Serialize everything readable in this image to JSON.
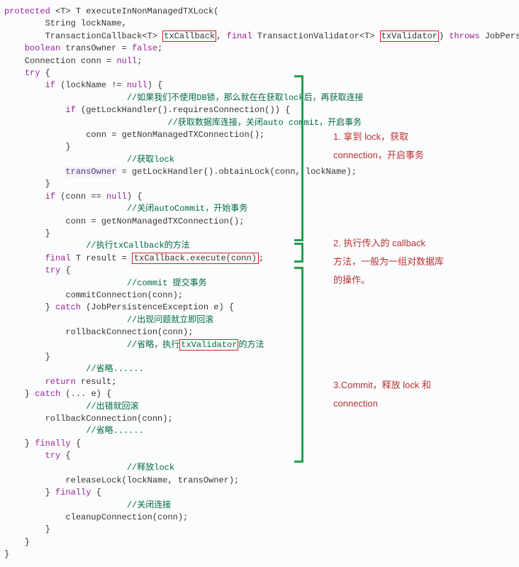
{
  "code": {
    "l1": "protected <T> T executeInNonManagedTXLock(",
    "l2": "        String lockName,",
    "l3a": "        TransactionCallback<T> ",
    "l3b": "txCallback",
    "l3c": ", final TransactionValidator<T> ",
    "l3d": "txValidator",
    "l3e": ") throws JobPersistenceException {",
    "l4": "    boolean transOwner = false;",
    "l5": "    Connection conn = null;",
    "l6": "    try {",
    "l7": "        if (lockName != null) {",
    "l8": "            //如果我们不使用DB锁，那么就在在获取lock后，再获取连接",
    "l9": "            if (getLockHandler().requiresConnection()) {",
    "l10": "                //获取数据库连接，关闭auto commit，开启事务",
    "l11": "                conn = getNonManagedTXConnection();",
    "l12": "            }",
    "l13": "            //获取lock",
    "l14a": "            ",
    "l14b": "transOwner",
    "l14c": " = getLockHandler().obtainLock(conn, lockName);",
    "l15": "        }",
    "l16": "        if (conn == null) {",
    "l17": "            //关闭autoCommit，开始事务",
    "l18": "            conn = getNonManagedTXConnection();",
    "l19": "        }",
    "l20": "        //执行txCallback的方法",
    "l21a": "        final T result = ",
    "l21b": "txCallback.execute(conn)",
    "l21c": ";",
    "l22": "        try {",
    "l23": "            //commit 提交事务",
    "l24": "            commitConnection(conn);",
    "l25": "        } catch (JobPersistenceException e) {",
    "l26": "            //出现问题就立即回滚",
    "l27": "            rollbackConnection(conn);",
    "l28a": "            //省略，执行",
    "l28b": "txValidator",
    "l28c": "的方法",
    "l29": "        }",
    "l30": "        //省略......",
    "l31": "        return result;",
    "l32": "    } catch (... e) {",
    "l33": "        //出错就回滚",
    "l34": "        rollbackConnection(conn);",
    "l35": "        //省略......",
    "l36": "    } finally {",
    "l37": "        try {",
    "l38": "            //释放lock",
    "l39": "            releaseLock(lockName, transOwner);",
    "l40": "        } finally {",
    "l41": "            //关闭连接",
    "l42": "            cleanupConnection(conn);",
    "l43": "        }",
    "l44": "    }",
    "l45": "}"
  },
  "annotations": {
    "a1": "1. 拿到 lock，获取",
    "a1b": "connection，开启事务",
    "a2": "2. 执行传入的 callback",
    "a2b": "方法，一般为一组对数据库",
    "a2c": "的操作。",
    "a3": "3.Commit，释放 lock 和",
    "a3b": "connection"
  }
}
